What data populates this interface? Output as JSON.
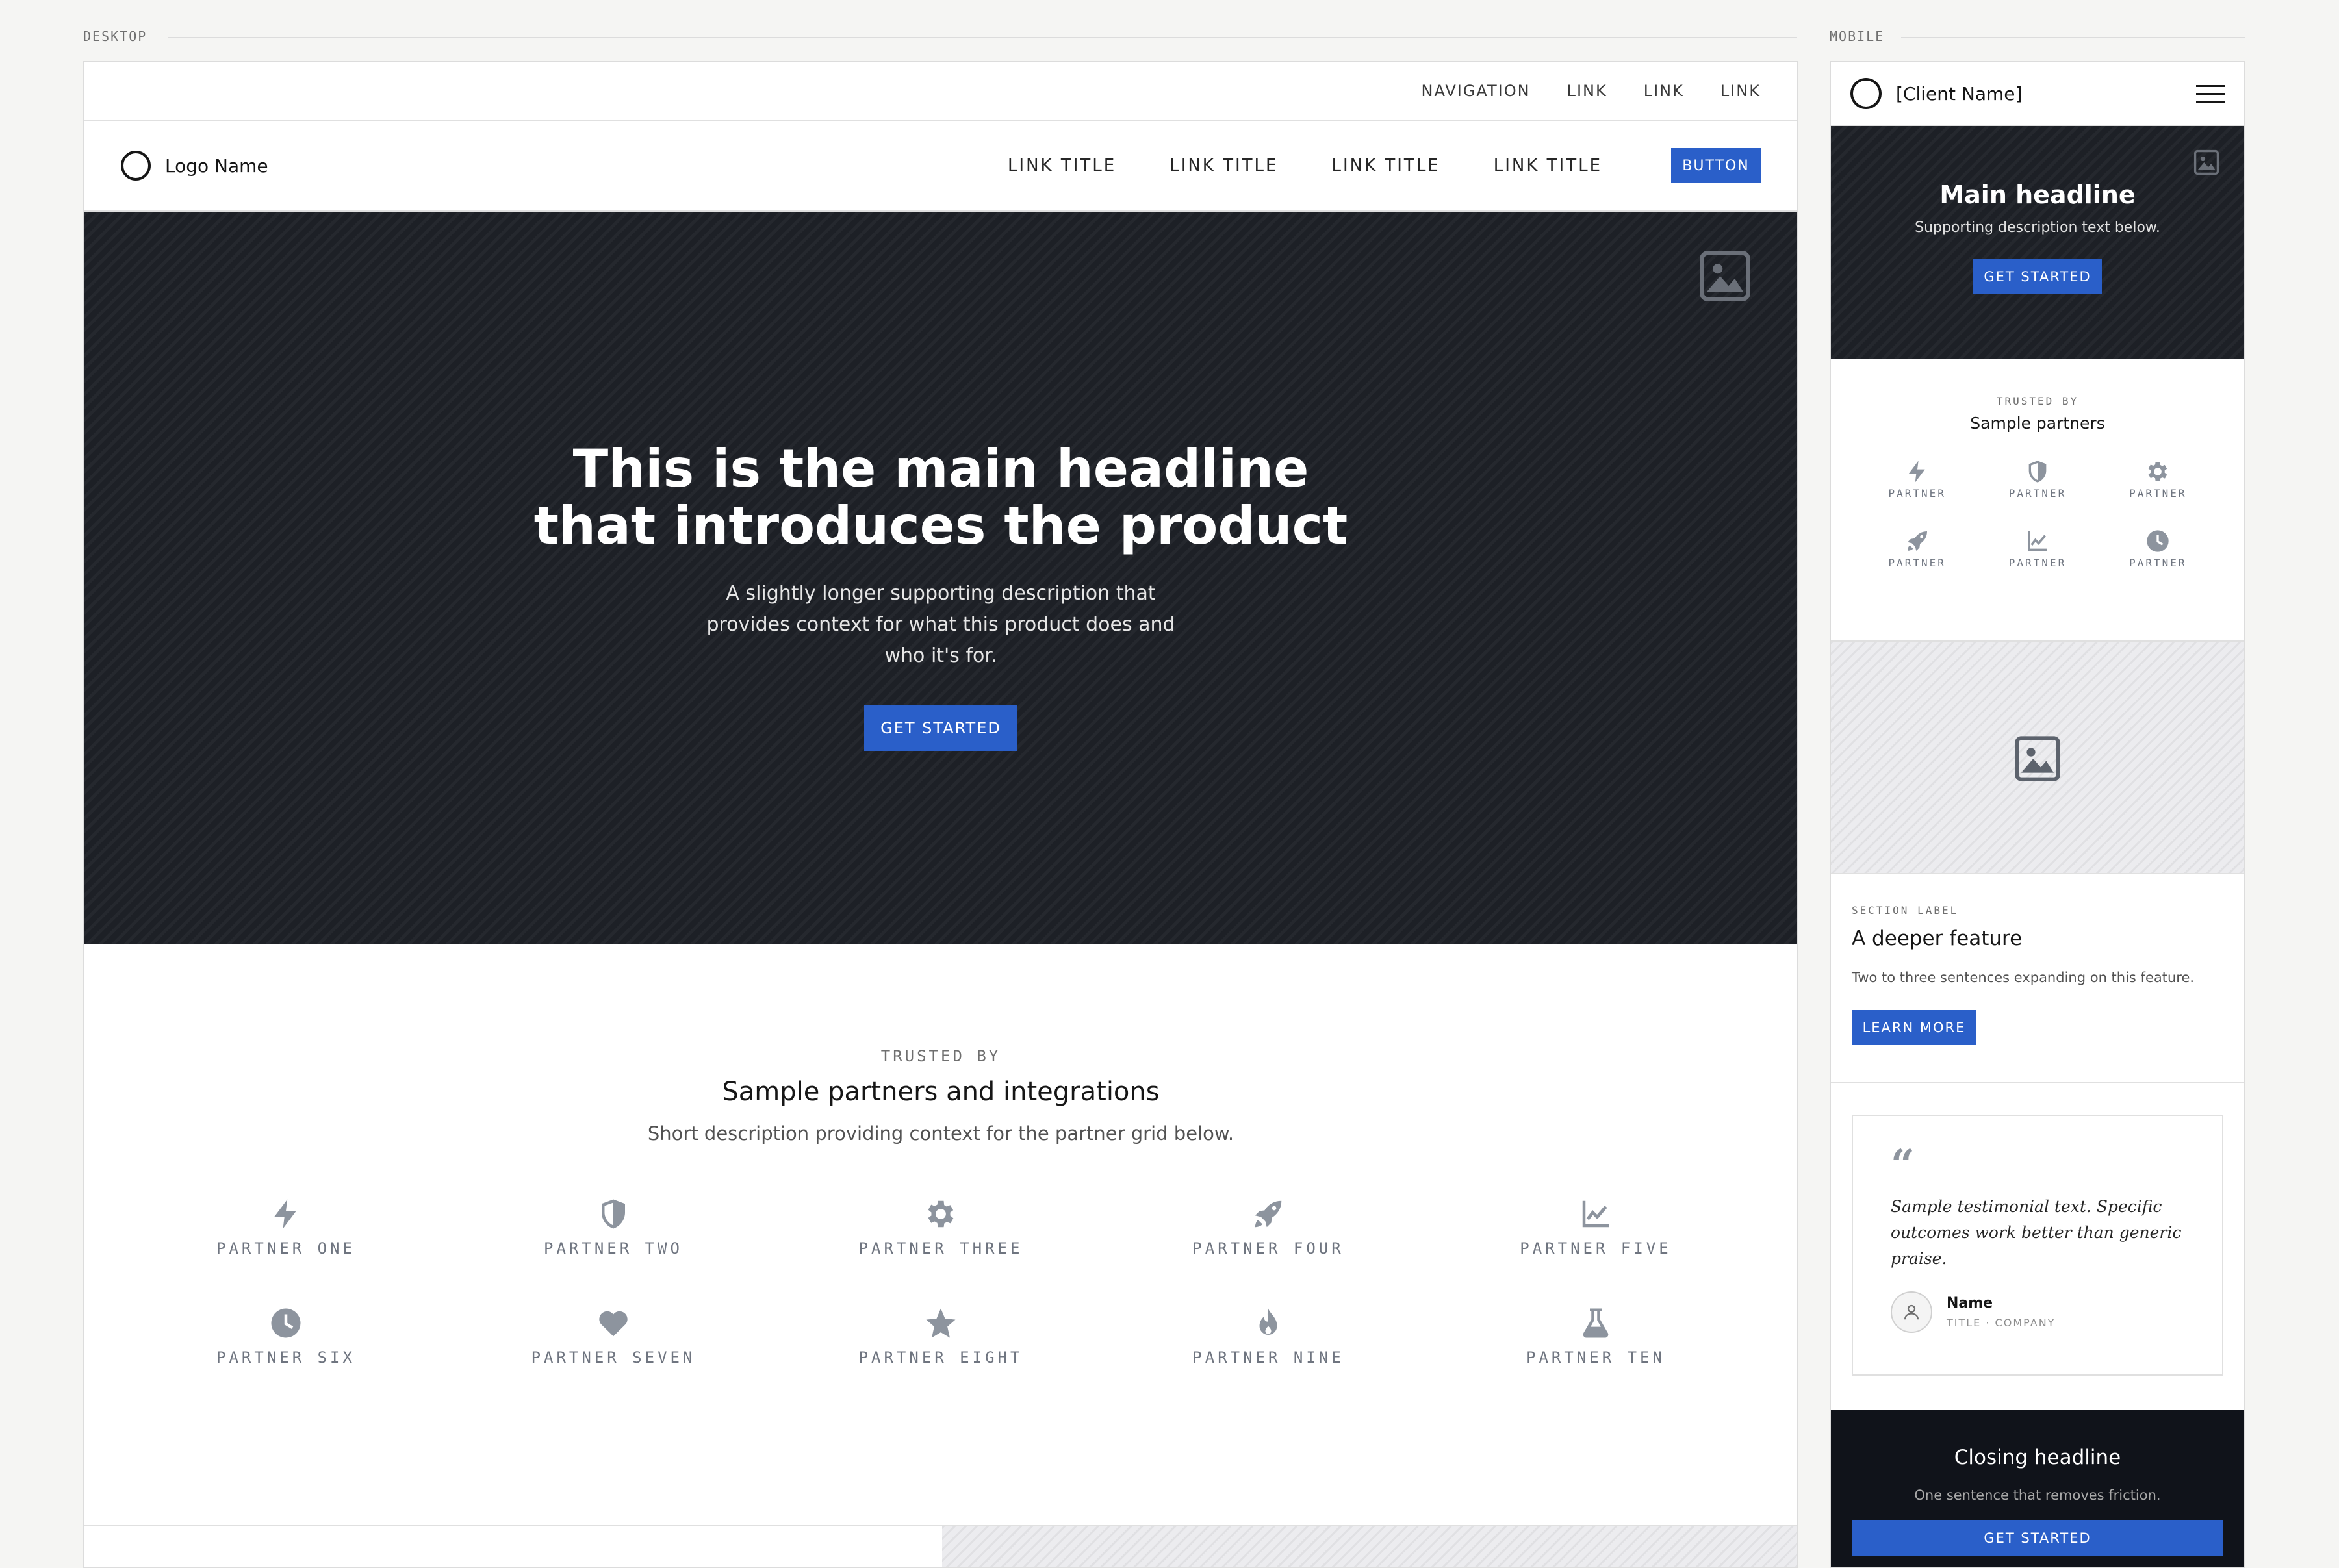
{
  "frames": {
    "desktop_label": "DESKTOP",
    "mobile_label": "MOBILE"
  },
  "colors": {
    "accent": "#2a5fc9",
    "hero_bg": "#1d2026",
    "closing_bg": "#10131a",
    "icon_gray": "#8d949e"
  },
  "desktop": {
    "utility_nav": [
      "NAVIGATION",
      "LINK",
      "LINK",
      "LINK"
    ],
    "logo_name": "Logo Name",
    "nav_links": [
      "LINK TITLE",
      "LINK TITLE",
      "LINK TITLE",
      "LINK TITLE"
    ],
    "nav_button": "BUTTON",
    "hero": {
      "title": "This is the main headline that introduces the product",
      "description": "A slightly longer supporting description that provides context for what this product does and who it's for.",
      "cta": "GET STARTED",
      "image_icon": "image-icon"
    },
    "partners": {
      "eyebrow": "TRUSTED BY",
      "title": "Sample partners and integrations",
      "description": "Short description providing context for the partner grid below.",
      "items": [
        {
          "label": "PARTNER ONE",
          "icon": "bolt-icon"
        },
        {
          "label": "PARTNER TWO",
          "icon": "shield-icon"
        },
        {
          "label": "PARTNER THREE",
          "icon": "gear-icon"
        },
        {
          "label": "PARTNER FOUR",
          "icon": "rocket-icon"
        },
        {
          "label": "PARTNER FIVE",
          "icon": "chart-line-icon"
        },
        {
          "label": "PARTNER SIX",
          "icon": "clock-icon"
        },
        {
          "label": "PARTNER SEVEN",
          "icon": "heart-icon"
        },
        {
          "label": "PARTNER EIGHT",
          "icon": "star-icon"
        },
        {
          "label": "PARTNER NINE",
          "icon": "flame-icon"
        },
        {
          "label": "PARTNER TEN",
          "icon": "flask-icon"
        }
      ]
    }
  },
  "mobile": {
    "client_name": "[Client Name]",
    "hero": {
      "title": "Main headline",
      "description": "Supporting description text below.",
      "cta": "GET STARTED"
    },
    "partners": {
      "eyebrow": "TRUSTED BY",
      "title": "Sample partners",
      "items": [
        {
          "label": "PARTNER",
          "icon": "bolt-icon"
        },
        {
          "label": "PARTNER",
          "icon": "shield-icon"
        },
        {
          "label": "PARTNER",
          "icon": "gear-icon"
        },
        {
          "label": "PARTNER",
          "icon": "rocket-icon"
        },
        {
          "label": "PARTNER",
          "icon": "chart-line-icon"
        },
        {
          "label": "PARTNER",
          "icon": "clock-icon"
        }
      ]
    },
    "feature": {
      "eyebrow": "SECTION LABEL",
      "title": "A deeper feature",
      "description": "Two to three sentences expanding on this feature.",
      "cta": "LEARN MORE"
    },
    "testimonial": {
      "quote": "Sample testimonial text. Specific outcomes work better than generic praise.",
      "name": "Name",
      "title": "TITLE · COMPANY"
    },
    "closing": {
      "title": "Closing headline",
      "description": "One sentence that removes friction.",
      "cta": "GET STARTED"
    }
  }
}
